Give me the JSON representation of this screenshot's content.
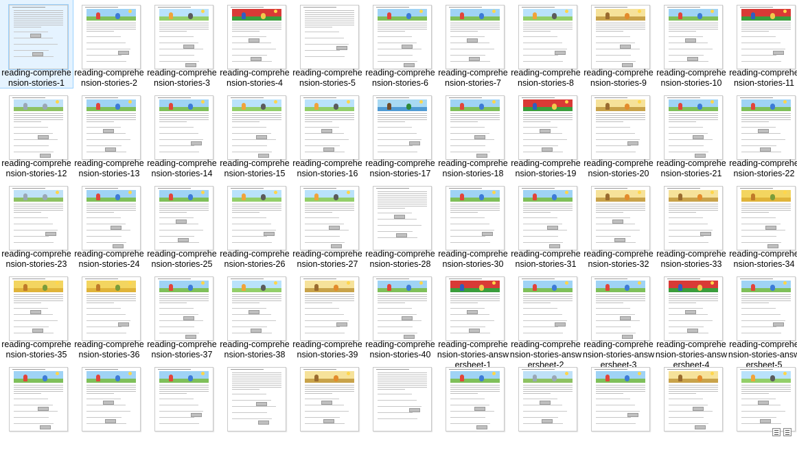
{
  "colors": {
    "selection_bg": "#e5f3ff",
    "selection_border": "#99d1ff"
  },
  "files": [
    {
      "name": "reading-comprehension-stories-1",
      "selected": true,
      "theme": "text"
    },
    {
      "name": "reading-comprehension-stories-2",
      "theme": "park"
    },
    {
      "name": "reading-comprehension-stories-3",
      "theme": "sky"
    },
    {
      "name": "reading-comprehension-stories-4",
      "theme": "red"
    },
    {
      "name": "reading-comprehension-stories-5",
      "theme": "text"
    },
    {
      "name": "reading-comprehension-stories-6",
      "theme": "park"
    },
    {
      "name": "reading-comprehension-stories-7",
      "theme": "park"
    },
    {
      "name": "reading-comprehension-stories-8",
      "theme": "sky"
    },
    {
      "name": "reading-comprehension-stories-9",
      "theme": "savanna"
    },
    {
      "name": "reading-comprehension-stories-10",
      "theme": "park"
    },
    {
      "name": "reading-comprehension-stories-11",
      "theme": "red"
    },
    {
      "name": "reading-comprehension-stories-12",
      "theme": "elephant"
    },
    {
      "name": "reading-comprehension-stories-13",
      "theme": "park"
    },
    {
      "name": "reading-comprehension-stories-14",
      "theme": "park"
    },
    {
      "name": "reading-comprehension-stories-15",
      "theme": "sky"
    },
    {
      "name": "reading-comprehension-stories-16",
      "theme": "sky"
    },
    {
      "name": "reading-comprehension-stories-17",
      "theme": "lake"
    },
    {
      "name": "reading-comprehension-stories-18",
      "theme": "park"
    },
    {
      "name": "reading-comprehension-stories-19",
      "theme": "red"
    },
    {
      "name": "reading-comprehension-stories-20",
      "theme": "savanna"
    },
    {
      "name": "reading-comprehension-stories-21",
      "theme": "park"
    },
    {
      "name": "reading-comprehension-stories-22",
      "theme": "park"
    },
    {
      "name": "reading-comprehension-stories-23",
      "theme": "elephant"
    },
    {
      "name": "reading-comprehension-stories-24",
      "theme": "park"
    },
    {
      "name": "reading-comprehension-stories-25",
      "theme": "park"
    },
    {
      "name": "reading-comprehension-stories-26",
      "theme": "sky"
    },
    {
      "name": "reading-comprehension-stories-27",
      "theme": "sky"
    },
    {
      "name": "reading-comprehension-stories-28",
      "theme": "text"
    },
    {
      "name": "reading-comprehension-stories-30",
      "theme": "park"
    },
    {
      "name": "reading-comprehension-stories-31",
      "theme": "park"
    },
    {
      "name": "reading-comprehension-stories-32",
      "theme": "savanna"
    },
    {
      "name": "reading-comprehension-stories-33",
      "theme": "savanna"
    },
    {
      "name": "reading-comprehension-stories-34",
      "theme": "wheat"
    },
    {
      "name": "reading-comprehension-stories-35",
      "theme": "wheat"
    },
    {
      "name": "reading-comprehension-stories-36",
      "theme": "wheat"
    },
    {
      "name": "reading-comprehension-stories-37",
      "theme": "park"
    },
    {
      "name": "reading-comprehension-stories-38",
      "theme": "sky"
    },
    {
      "name": "reading-comprehension-stories-39",
      "theme": "savanna"
    },
    {
      "name": "reading-comprehension-stories-40",
      "theme": "park"
    },
    {
      "name": "reading-comprehension-stories-answersheet-1",
      "theme": "red"
    },
    {
      "name": "reading-comprehension-stories-answersheet-2",
      "theme": "park"
    },
    {
      "name": "reading-comprehension-stories-answersheet-3",
      "theme": "park"
    },
    {
      "name": "reading-comprehension-stories-answersheet-4",
      "theme": "red"
    },
    {
      "name": "reading-comprehension-stories-answersheet-5",
      "theme": "park"
    },
    {
      "name": "",
      "theme": "park"
    },
    {
      "name": "",
      "theme": "park"
    },
    {
      "name": "",
      "theme": "park"
    },
    {
      "name": "",
      "theme": "text"
    },
    {
      "name": "",
      "theme": "savanna"
    },
    {
      "name": "",
      "theme": "text"
    },
    {
      "name": "",
      "theme": "park"
    },
    {
      "name": "",
      "theme": "elephant"
    },
    {
      "name": "",
      "theme": "park"
    },
    {
      "name": "",
      "theme": "savanna"
    },
    {
      "name": "",
      "theme": "sky"
    }
  ]
}
